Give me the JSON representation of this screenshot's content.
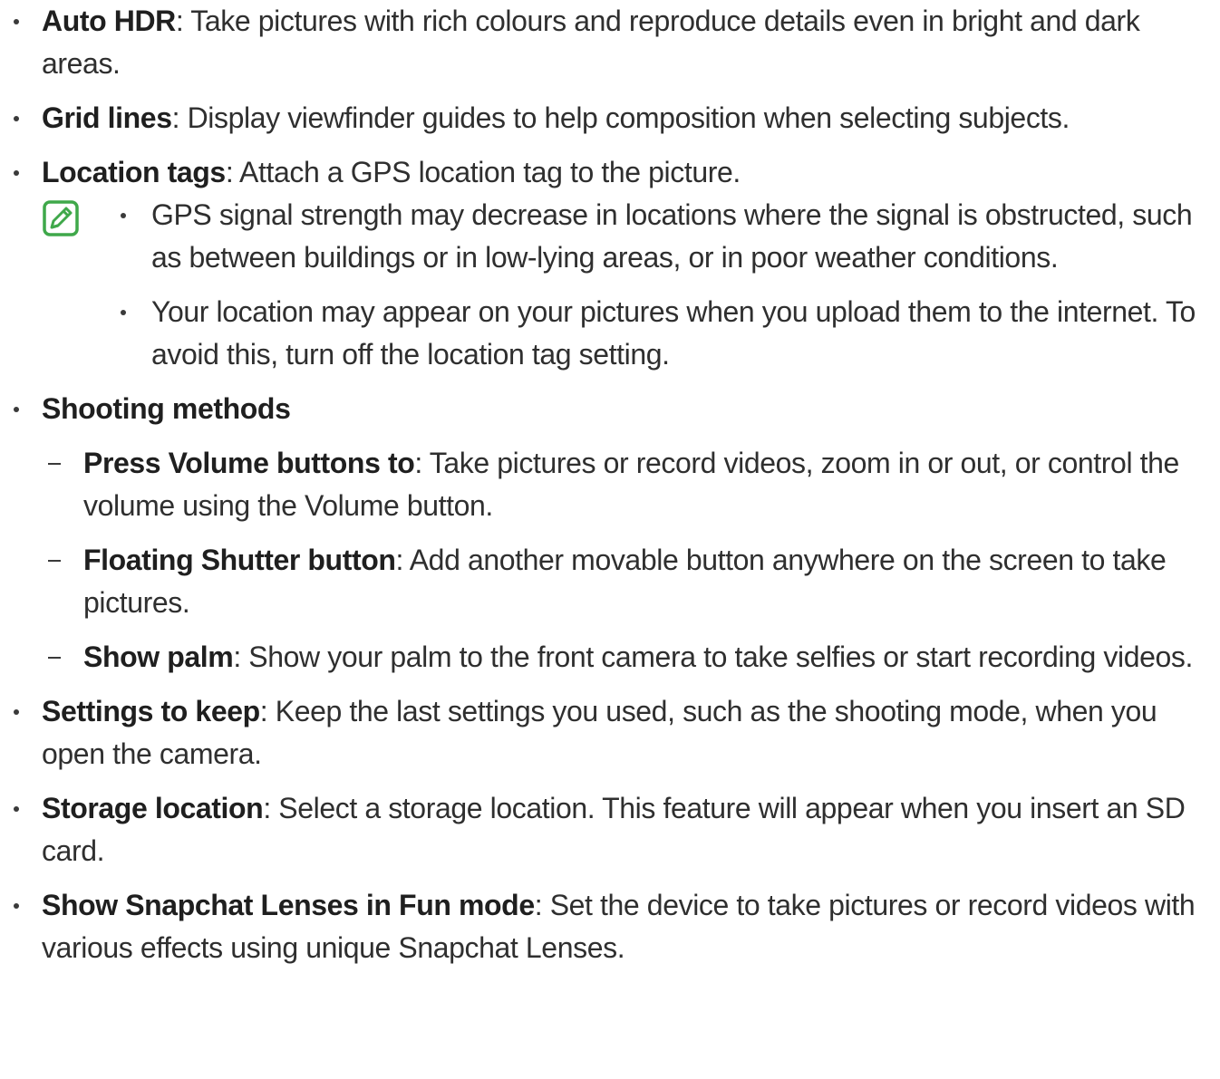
{
  "items": [
    {
      "term": "Auto HDR",
      "desc": ": Take pictures with rich colours and reproduce details even in bright and dark areas."
    },
    {
      "term": "Grid lines",
      "desc": ": Display viewfinder guides to help composition when selecting subjects."
    },
    {
      "term": "Location tags",
      "desc": ": Attach a GPS location tag to the picture."
    }
  ],
  "note": {
    "icon": "note-pencil-icon",
    "icon_color": "#3fa84a",
    "bullets": [
      "GPS signal strength may decrease in locations where the signal is obstructed, such as between buildings or in low-lying areas, or in poor weather conditions.",
      "Your location may appear on your pictures when you upload them to the internet. To avoid this, turn off the location tag setting."
    ]
  },
  "shooting": {
    "term": "Shooting methods",
    "subitems": [
      {
        "term": "Press Volume buttons to",
        "desc": ": Take pictures or record videos, zoom in or out, or control the volume using the Volume button."
      },
      {
        "term": "Floating Shutter button",
        "desc": ": Add another movable button anywhere on the screen to take pictures."
      },
      {
        "term": "Show palm",
        "desc": ": Show your palm to the front camera to take selfies or start recording videos."
      }
    ]
  },
  "items2": [
    {
      "term": "Settings to keep",
      "desc": ": Keep the last settings you used, such as the shooting mode, when you open the camera."
    },
    {
      "term": "Storage location",
      "desc": ": Select a storage location. This feature will appear when you insert an SD card."
    },
    {
      "term": "Show Snapchat Lenses in Fun mode",
      "desc": ": Set the device to take pictures or record videos with various effects using unique Snapchat Lenses."
    }
  ]
}
